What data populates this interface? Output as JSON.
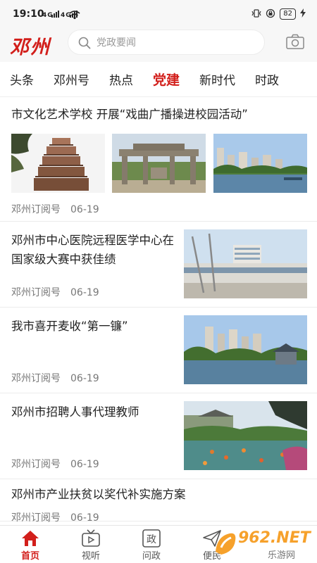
{
  "status_bar": {
    "time": "19:10",
    "signal_text": "4G 4G",
    "battery": "82"
  },
  "header": {
    "logo": "邓州",
    "search_placeholder": "党政要闻",
    "camera_icon": "camera-icon"
  },
  "tabs": [
    {
      "label": "头条",
      "active": false
    },
    {
      "label": "邓州号",
      "active": false
    },
    {
      "label": "热点",
      "active": false
    },
    {
      "label": "党建",
      "active": true
    },
    {
      "label": "新时代",
      "active": false
    },
    {
      "label": "时政",
      "active": false
    }
  ],
  "news": [
    {
      "title": "市文化艺术学校 开展“戏曲广播操进校园活动”",
      "source": "邓州订阅号",
      "date": "06-19",
      "layout": "three-images"
    },
    {
      "title": "邓州市中心医院远程医学中心在国家级大赛中获佳绩",
      "source": "邓州订阅号",
      "date": "06-19",
      "layout": "right-image"
    },
    {
      "title": "我市喜开麦收“第一镰”",
      "source": "邓州订阅号",
      "date": "06-19",
      "layout": "right-image"
    },
    {
      "title": "邓州市招聘人事代理教师",
      "source": "邓州订阅号",
      "date": "06-19",
      "layout": "right-image"
    },
    {
      "title": "邓州市产业扶贫以奖代补实施方案",
      "source": "邓州订阅号",
      "date": "06-19",
      "layout": "text-only"
    }
  ],
  "bottom_nav": [
    {
      "label": "首页",
      "icon": "home-icon",
      "active": true
    },
    {
      "label": "视听",
      "icon": "tv-icon",
      "active": false
    },
    {
      "label": "问政",
      "icon": "zheng-icon",
      "active": false
    },
    {
      "label": "便民",
      "icon": "send-icon",
      "active": false
    }
  ],
  "watermark": {
    "text": "962.NET",
    "sub": "乐游网"
  },
  "colors": {
    "accent": "#d21f1b",
    "header_bg": "#f7f7f7",
    "watermark": "#f6a12b"
  }
}
